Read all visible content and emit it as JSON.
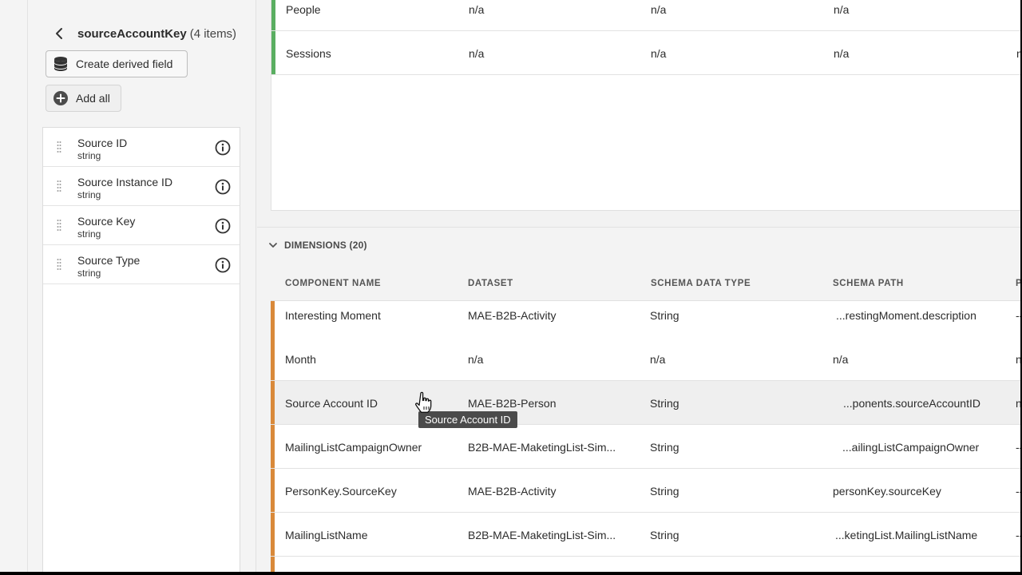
{
  "panel": {
    "title": "sourceAccountKey",
    "count": "(4 items)",
    "create_derived_label": "Create derived field",
    "add_all_label": "Add all",
    "fields": [
      {
        "name": "Source ID",
        "type": "string"
      },
      {
        "name": "Source Instance ID",
        "type": "string"
      },
      {
        "name": "Source Key",
        "type": "string"
      },
      {
        "name": "Source Type",
        "type": "string"
      }
    ]
  },
  "top_table": {
    "rows": [
      {
        "name": "People",
        "dataset": "n/a",
        "schema_type": "n/a",
        "schema_path": "n/a",
        "extra": ""
      },
      {
        "name": "Sessions",
        "dataset": "n/a",
        "schema_type": "n/a",
        "schema_path": "n/a",
        "extra": "n"
      }
    ]
  },
  "dimensions": {
    "header": "DIMENSIONS (20)",
    "columns": {
      "name": "COMPONENT NAME",
      "dataset": "DATASET",
      "schema_type": "SCHEMA DATA TYPE",
      "schema_path": "SCHEMA PATH",
      "extra": "P"
    },
    "rows": [
      {
        "name": "Interesting Moment",
        "dataset": "MAE-B2B-Activity",
        "schema_type": "String",
        "schema_path": "...restingMoment.description",
        "extra": "--"
      },
      {
        "name": "Month",
        "dataset": "n/a",
        "schema_type": "n/a",
        "schema_path": "n/a",
        "extra": "n"
      },
      {
        "name": "Source Account ID",
        "dataset": "MAE-B2B-Person",
        "schema_type": "String",
        "schema_path": "...ponents.sourceAccountID",
        "extra": "n"
      },
      {
        "name": "MailingListCampaignOwner",
        "dataset": "B2B-MAE-MaketingList-Sim...",
        "schema_type": "String",
        "schema_path": "...ailingListCampaignOwner",
        "extra": "--"
      },
      {
        "name": "PersonKey.SourceKey",
        "dataset": "MAE-B2B-Activity",
        "schema_type": "String",
        "schema_path": "personKey.sourceKey",
        "extra": "--"
      },
      {
        "name": "MailingListName",
        "dataset": "B2B-MAE-MaketingList-Sim...",
        "schema_type": "String",
        "schema_path": "...ketingList.MailingListName",
        "extra": "--"
      }
    ]
  },
  "tooltip": "Source Account ID",
  "colors": {
    "metric_bar": "#5aae61",
    "dimension_bar": "#d9893a"
  }
}
